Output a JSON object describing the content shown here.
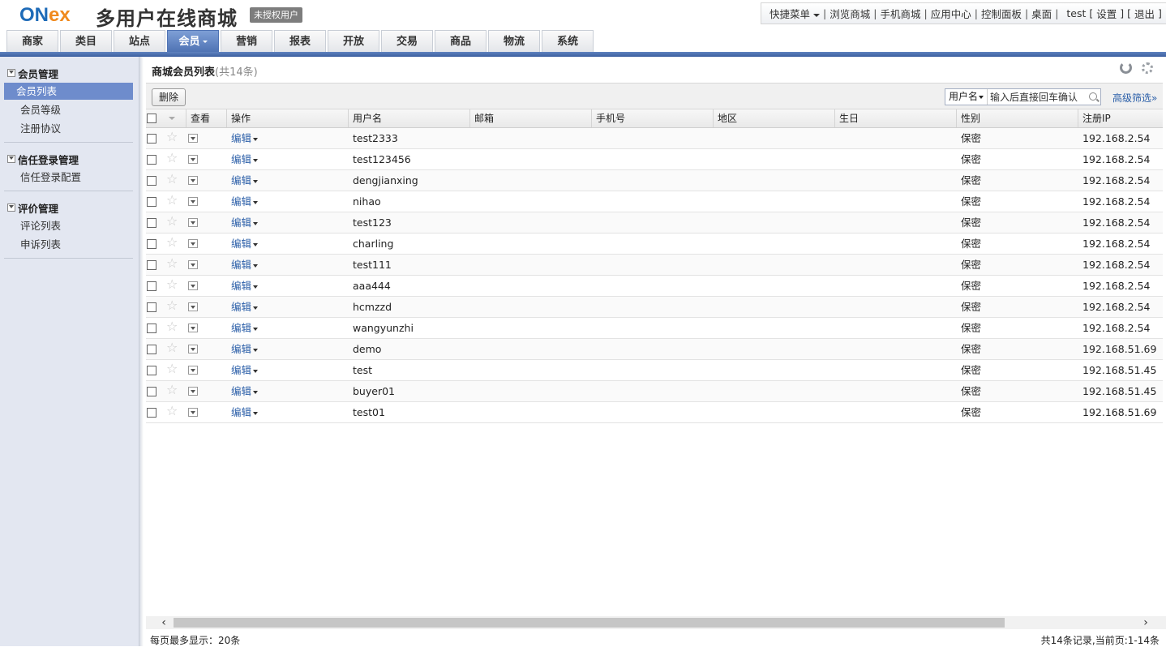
{
  "header": {
    "logo": {
      "on": "ON",
      "ex": "ex"
    },
    "site_title": "多用户在线商城",
    "auth_badge": "未授权用户",
    "quick_menu": "快捷菜单",
    "links": [
      "浏览商城",
      "手机商城",
      "应用中心",
      "控制面板",
      "桌面"
    ],
    "user": "test",
    "settings": "设置",
    "logout": "退出"
  },
  "nav": {
    "tabs": [
      "商家",
      "类目",
      "站点",
      "会员",
      "营销",
      "报表",
      "开放",
      "交易",
      "商品",
      "物流",
      "系统"
    ],
    "active": "会员"
  },
  "sidebar": {
    "groups": [
      {
        "title": "会员管理",
        "items": [
          "会员列表",
          "会员等级",
          "注册协议"
        ]
      },
      {
        "title": "信任登录管理",
        "items": [
          "信任登录配置"
        ]
      },
      {
        "title": "评价管理",
        "items": [
          "评论列表",
          "申诉列表"
        ]
      }
    ],
    "active_item": "会员列表"
  },
  "main": {
    "title": "商城会员列表",
    "count": "(共14条)",
    "delete_label": "删除",
    "search": {
      "field": "用户名",
      "placeholder": "输入后直接回车确认"
    },
    "adv_filter": "高级筛选»",
    "columns": [
      "查看",
      "操作",
      "用户名",
      "邮箱",
      "手机号",
      "地区",
      "生日",
      "性别",
      "注册IP"
    ],
    "edit_label": "编辑",
    "rows": [
      {
        "username": "test2333",
        "gender": "保密",
        "ip": "192.168.2.54"
      },
      {
        "username": "test123456",
        "gender": "保密",
        "ip": "192.168.2.54"
      },
      {
        "username": "dengjianxing",
        "gender": "保密",
        "ip": "192.168.2.54"
      },
      {
        "username": "nihao",
        "gender": "保密",
        "ip": "192.168.2.54"
      },
      {
        "username": "test123",
        "gender": "保密",
        "ip": "192.168.2.54"
      },
      {
        "username": "charling",
        "gender": "保密",
        "ip": "192.168.2.54"
      },
      {
        "username": "test111",
        "gender": "保密",
        "ip": "192.168.2.54"
      },
      {
        "username": "aaa444",
        "gender": "保密",
        "ip": "192.168.2.54"
      },
      {
        "username": "hcmzzd",
        "gender": "保密",
        "ip": "192.168.2.54"
      },
      {
        "username": "wangyunzhi",
        "gender": "保密",
        "ip": "192.168.2.54"
      },
      {
        "username": "demo",
        "gender": "保密",
        "ip": "192.168.51.69"
      },
      {
        "username": "test",
        "gender": "保密",
        "ip": "192.168.51.45"
      },
      {
        "username": "buyer01",
        "gender": "保密",
        "ip": "192.168.51.45"
      },
      {
        "username": "test01",
        "gender": "保密",
        "ip": "192.168.51.69"
      }
    ],
    "page_size_label": "每页最多显示：",
    "page_size": "20条",
    "summary": "共14条记录,当前页:1-14条"
  }
}
